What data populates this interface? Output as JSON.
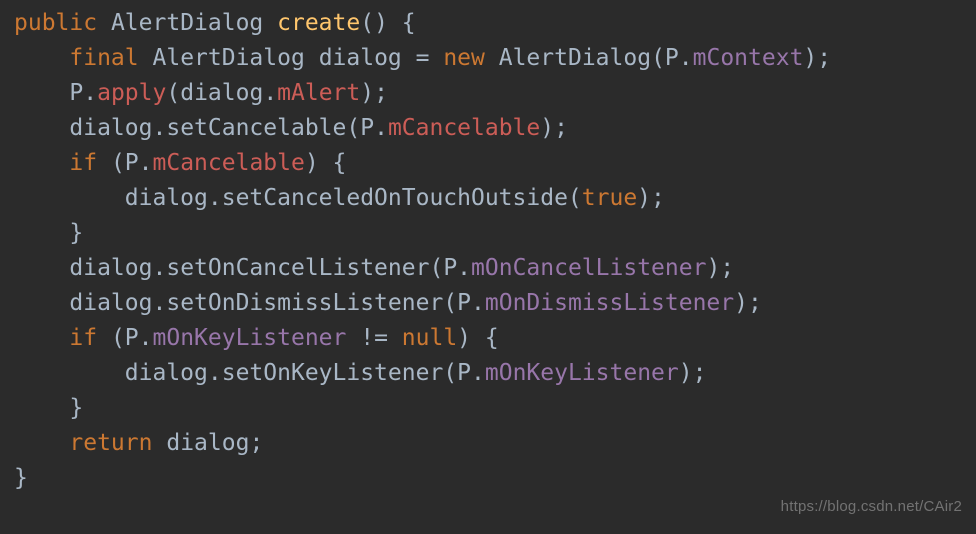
{
  "code": {
    "line1": {
      "kw1": "public",
      "sp": " ",
      "type1": "AlertDialog",
      "name": "create",
      "sig": "() {"
    },
    "line2": {
      "indent": "    ",
      "kw1": "final",
      "type1": "AlertDialog",
      "var": "dialog",
      "op": " = ",
      "kw2": "new",
      "type2": "AlertDialog",
      "lp": "(",
      "obj": "P",
      "dot": ".",
      "field": "mContext",
      "rp": ");"
    },
    "line3": {
      "indent": "    ",
      "obj": "P",
      "dot": ".",
      "call": "apply",
      "lp": "(",
      "arg1": "dialog",
      "dot2": ".",
      "field": "mAlert",
      "rp": ");"
    },
    "line4": {
      "indent": "    ",
      "recv": "dialog",
      "dot": ".",
      "call": "setCancelable",
      "lp": "(",
      "obj": "P",
      "dot2": ".",
      "field": "mCancelable",
      "rp": ");"
    },
    "line5": {
      "indent": "    ",
      "kw": "if",
      "lp": " (",
      "obj": "P",
      "dot": ".",
      "field": "mCancelable",
      "rp": ") {"
    },
    "line6": {
      "indent": "        ",
      "recv": "dialog",
      "dot": ".",
      "call": "setCanceledOnTouchOutside",
      "lp": "(",
      "lit": "true",
      "rp": ");"
    },
    "line7": {
      "indent": "    ",
      "brace": "}"
    },
    "line8": {
      "indent": "    ",
      "recv": "dialog",
      "dot": ".",
      "call": "setOnCancelListener",
      "lp": "(",
      "obj": "P",
      "dot2": ".",
      "field": "mOnCancelListener",
      "rp": ");"
    },
    "line9": {
      "indent": "    ",
      "recv": "dialog",
      "dot": ".",
      "call": "setOnDismissListener",
      "lp": "(",
      "obj": "P",
      "dot2": ".",
      "field": "mOnDismissListener",
      "rp": ");"
    },
    "line10": {
      "indent": "    ",
      "kw": "if",
      "lp": " (",
      "obj": "P",
      "dot": ".",
      "field": "mOnKeyListener",
      "op": " != ",
      "lit": "null",
      "rp": ") {"
    },
    "line11": {
      "indent": "        ",
      "recv": "dialog",
      "dot": ".",
      "call": "setOnKeyListener",
      "lp": "(",
      "obj": "P",
      "dot2": ".",
      "field": "mOnKeyListener",
      "rp": ");"
    },
    "line12": {
      "indent": "    ",
      "brace": "}"
    },
    "line13": {
      "indent": "    ",
      "kw": "return",
      "sp": " ",
      "var": "dialog",
      "semi": ";"
    },
    "line14": {
      "brace": "}"
    }
  },
  "watermark": "https://blog.csdn.net/CAir2"
}
